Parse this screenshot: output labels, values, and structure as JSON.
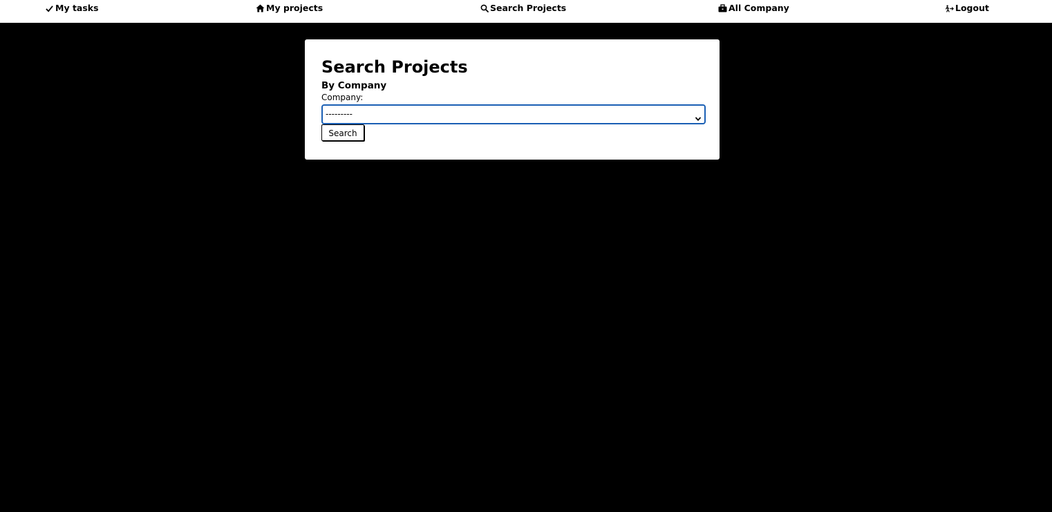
{
  "nav": {
    "my_tasks": {
      "label": "My tasks",
      "icon": "check-icon"
    },
    "my_projects": {
      "label": "My projects",
      "icon": "home-icon"
    },
    "search_projects": {
      "label": "Search Projects",
      "icon": "search-icon"
    },
    "all_company": {
      "label": "All Company",
      "icon": "briefcase-icon"
    },
    "logout": {
      "label": "Logout",
      "icon": "logout-walk-icon"
    }
  },
  "search": {
    "title": "Search Projects",
    "subtitle": "By Company",
    "company_label": "Company:",
    "company_selected": "---------",
    "button_label": "Search"
  },
  "colors": {
    "background": "#000000",
    "nav_background": "#ffffff",
    "card_background": "#ffffff",
    "select_focus_border": "#1a5fb4"
  }
}
